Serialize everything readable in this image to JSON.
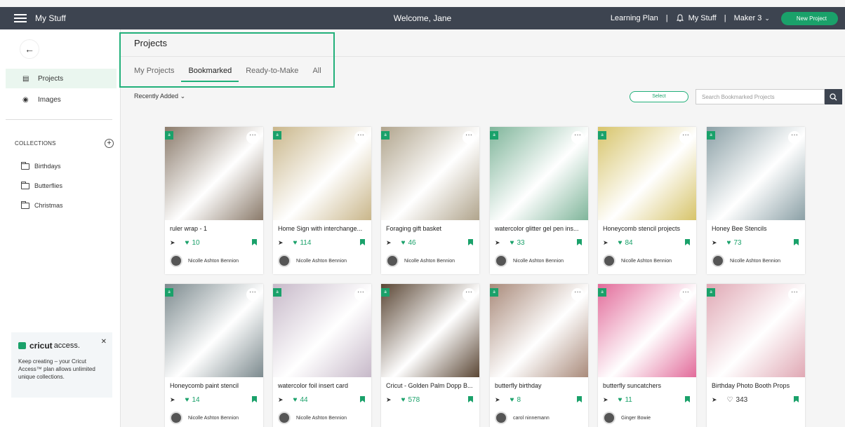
{
  "topbar": {
    "app_title": "My Stuff",
    "welcome": "Welcome, Jane",
    "learning_plan": "Learning Plan",
    "separator": "|",
    "my_stuff": "My Stuff",
    "machine": "Maker 3",
    "new_project": "New Project"
  },
  "sidebar": {
    "projects": "Projects",
    "images": "Images",
    "collections_heading": "COLLECTIONS",
    "collections": [
      "Birthdays",
      "Butterflies",
      "Christmas"
    ],
    "promo": {
      "brand": "cricut",
      "brand_suffix": "access.",
      "text": "Keep creating – your Cricut Access™ plan allows unlimited unique collections."
    }
  },
  "main": {
    "title": "Projects",
    "tabs": [
      "My Projects",
      "Bookmarked",
      "Ready-to-Make",
      "All"
    ],
    "active_tab": "Bookmarked",
    "sort": "Recently Added",
    "select_label": "Select",
    "search_placeholder": "Search Bookmarked Projects"
  },
  "cards": [
    {
      "title": "ruler wrap - 1",
      "likes": "10",
      "author": "Nicolle Ashton Bennion",
      "liked": true,
      "color": "#8a7a6a"
    },
    {
      "title": "Home Sign with interchange...",
      "likes": "114",
      "author": "Nicolle Ashton Bennion",
      "liked": true,
      "color": "#c9b68a"
    },
    {
      "title": "Foraging gift basket",
      "likes": "46",
      "author": "Nicolle Ashton Bennion",
      "liked": true,
      "color": "#b0a48c"
    },
    {
      "title": "watercolor glitter gel pen ins...",
      "likes": "33",
      "author": "Nicolle Ashton Bennion",
      "liked": true,
      "color": "#7fb59a"
    },
    {
      "title": "Honeycomb stencil projects",
      "likes": "84",
      "author": "Nicolle Ashton Bennion",
      "liked": true,
      "color": "#d7c46a"
    },
    {
      "title": "Honey Bee Stencils",
      "likes": "73",
      "author": "Nicolle Ashton Bennion",
      "liked": true,
      "color": "#8ba0a6"
    },
    {
      "title": "Honeycomb paint stencil",
      "likes": "14",
      "author": "Nicolle Ashton Bennion",
      "liked": true,
      "color": "#7c8a8e"
    },
    {
      "title": "watercolor foil insert card",
      "likes": "44",
      "author": "Nicolle Ashton Bennion",
      "liked": true,
      "color": "#c7b9c9"
    },
    {
      "title": "Cricut - Golden Palm Dopp B...",
      "likes": "578",
      "author": "",
      "liked": true,
      "color": "#5a4634"
    },
    {
      "title": "butterfly birthday",
      "likes": "8",
      "author": "carol ninnemann",
      "liked": true,
      "color": "#a98a7a"
    },
    {
      "title": "butterfly suncatchers",
      "likes": "11",
      "author": "Ginger Bowie",
      "liked": true,
      "color": "#e26b9a"
    },
    {
      "title": "Birthday Photo Booth Props",
      "likes": "343",
      "author": "",
      "liked": false,
      "color": "#e0a8b4"
    }
  ],
  "colors": {
    "accent": "#1aa16a",
    "topbar": "#3d4450"
  }
}
